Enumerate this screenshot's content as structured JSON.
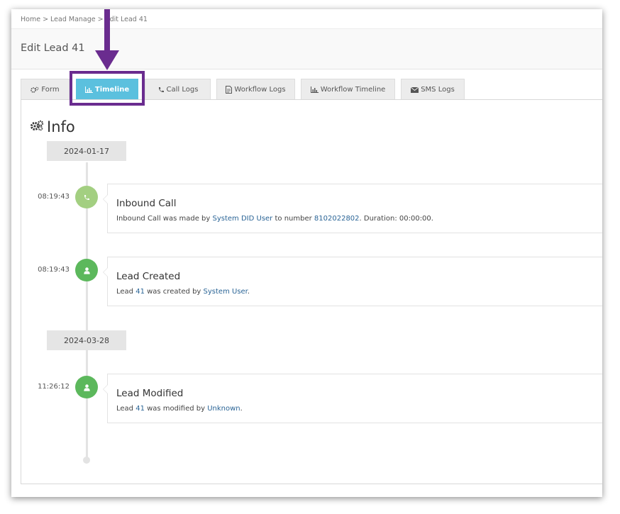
{
  "breadcrumb": {
    "home": "Home",
    "lead_manage": "Lead Manage",
    "current": "Edit Lead 41",
    "separator": ">"
  },
  "page": {
    "title": "Edit Lead 41"
  },
  "tabs": [
    {
      "label": "Form",
      "icon": "gears-icon"
    },
    {
      "label": "Timeline",
      "icon": "bar-chart-icon",
      "active": true
    },
    {
      "label": "Call Logs",
      "icon": "phone-icon"
    },
    {
      "label": "Workflow Logs",
      "icon": "document-icon"
    },
    {
      "label": "Workflow Timeline",
      "icon": "bar-chart-icon"
    },
    {
      "label": "SMS Logs",
      "icon": "envelope-icon"
    }
  ],
  "info": {
    "title": "Info",
    "icon": "gears-icon"
  },
  "timeline": {
    "dates": [
      "2024-01-17",
      "2024-03-28"
    ],
    "events": [
      {
        "time": "08:19:43",
        "icon": "phone-icon",
        "title": "Inbound Call",
        "text1": "Inbound Call was made by ",
        "link1": "System DID User",
        "text2": " to number ",
        "link2": "8102022802",
        "text3": ". Duration: 00:00:00."
      },
      {
        "time": "08:19:43",
        "icon": "user-icon",
        "title": "Lead Created",
        "text1": "Lead ",
        "link1": "41",
        "text2": " was created by ",
        "link2": "System User",
        "text3": "."
      },
      {
        "time": "11:26:12",
        "icon": "user-icon",
        "title": "Lead Modified",
        "text1": "Lead ",
        "link1": "41",
        "text2": " was modified by ",
        "link2": "Unknown",
        "text3": "."
      }
    ]
  },
  "colors": {
    "active_tab": "#5bc0de",
    "annotation": "#6a2c8f",
    "call_node": "#a3cf81",
    "user_node": "#5cb85c",
    "link": "#2a6496"
  }
}
